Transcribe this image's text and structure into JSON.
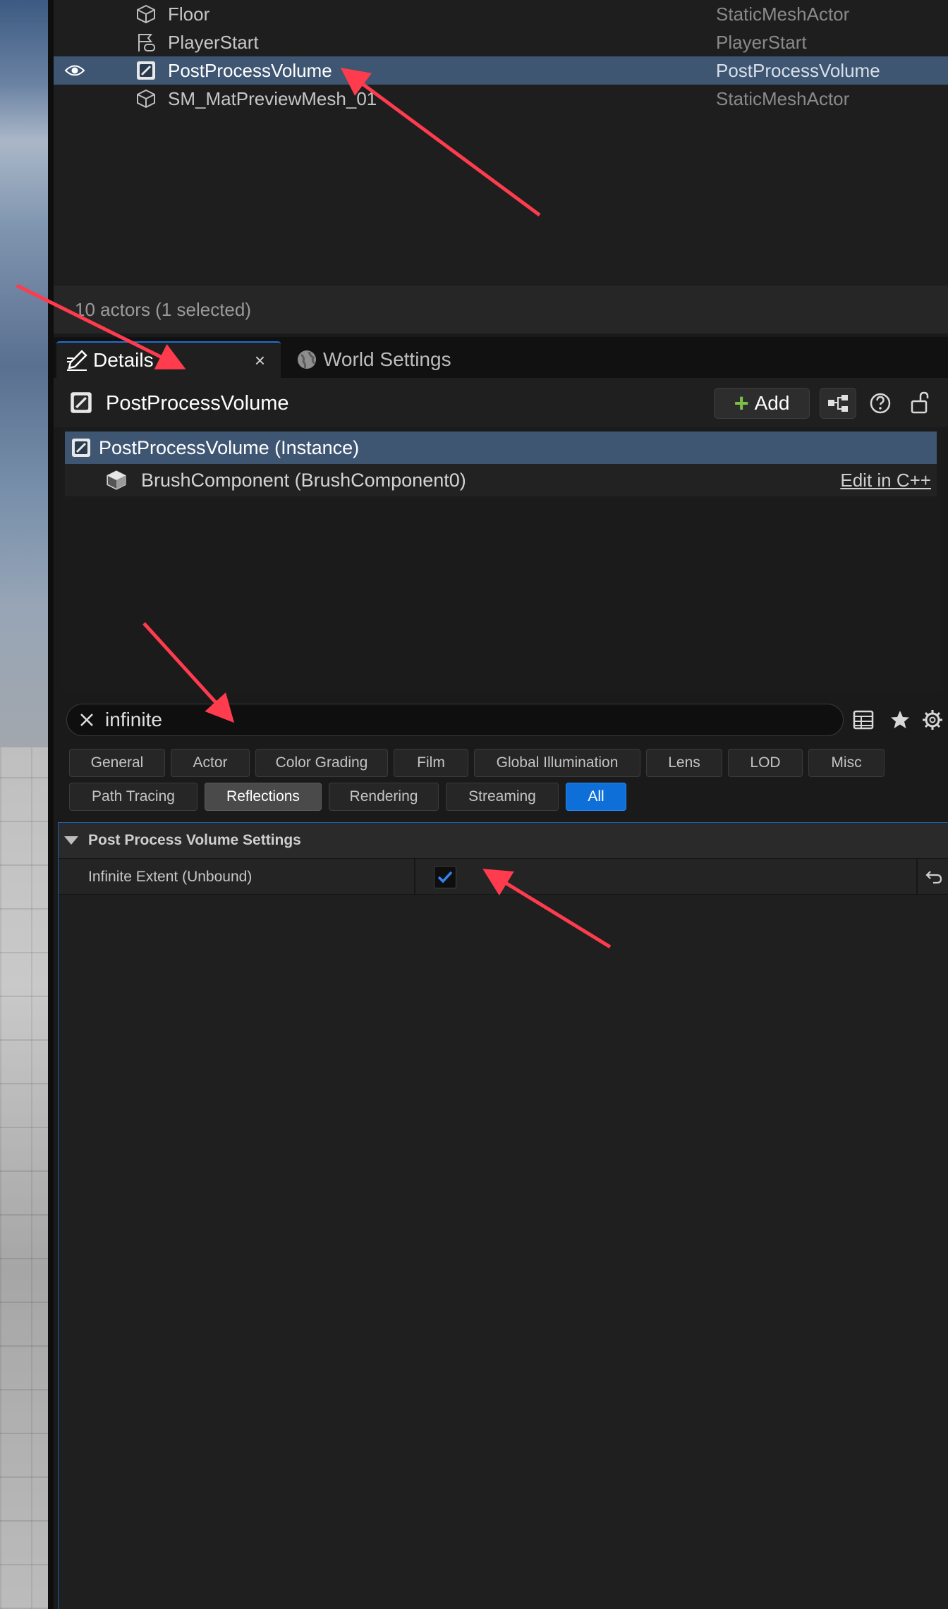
{
  "outliner": {
    "rows": [
      {
        "label": "Floor",
        "type": "StaticMeshActor",
        "icon": "static-mesh-icon"
      },
      {
        "label": "PlayerStart",
        "type": "PlayerStart",
        "icon": "player-start-icon"
      },
      {
        "label": "PostProcessVolume",
        "type": "PostProcessVolume",
        "icon": "post-process-volume-icon",
        "selected": true
      },
      {
        "label": "SM_MatPreviewMesh_01",
        "type": "StaticMeshActor",
        "icon": "static-mesh-icon"
      }
    ],
    "status": "10 actors (1 selected)"
  },
  "tabs": {
    "details": "Details",
    "details_close": "×",
    "world_settings": "World Settings"
  },
  "details": {
    "object_name": "PostProcessVolume",
    "add_label": "Add",
    "components": {
      "root": "PostProcessVolume (Instance)",
      "child": "BrushComponent (BrushComponent0)",
      "edit_cpp": "Edit in C++"
    },
    "search": {
      "value": "infinite"
    },
    "categories": [
      "General",
      "Actor",
      "Color Grading",
      "Film",
      "Global Illumination",
      "Lens",
      "LOD",
      "Misc",
      "Path Tracing",
      "Reflections",
      "Rendering",
      "Streaming",
      "All"
    ],
    "selected_categories": [
      "Reflections"
    ],
    "active_category": "All",
    "section_title": "Post Process Volume Settings",
    "property": {
      "name": "Infinite Extent (Unbound)",
      "checked": true
    }
  },
  "colors": {
    "selection": "#3f5673",
    "accent": "#0f6fd8",
    "annotation_arrow": "#ff3b4e",
    "add_plus": "#7cc04a"
  }
}
